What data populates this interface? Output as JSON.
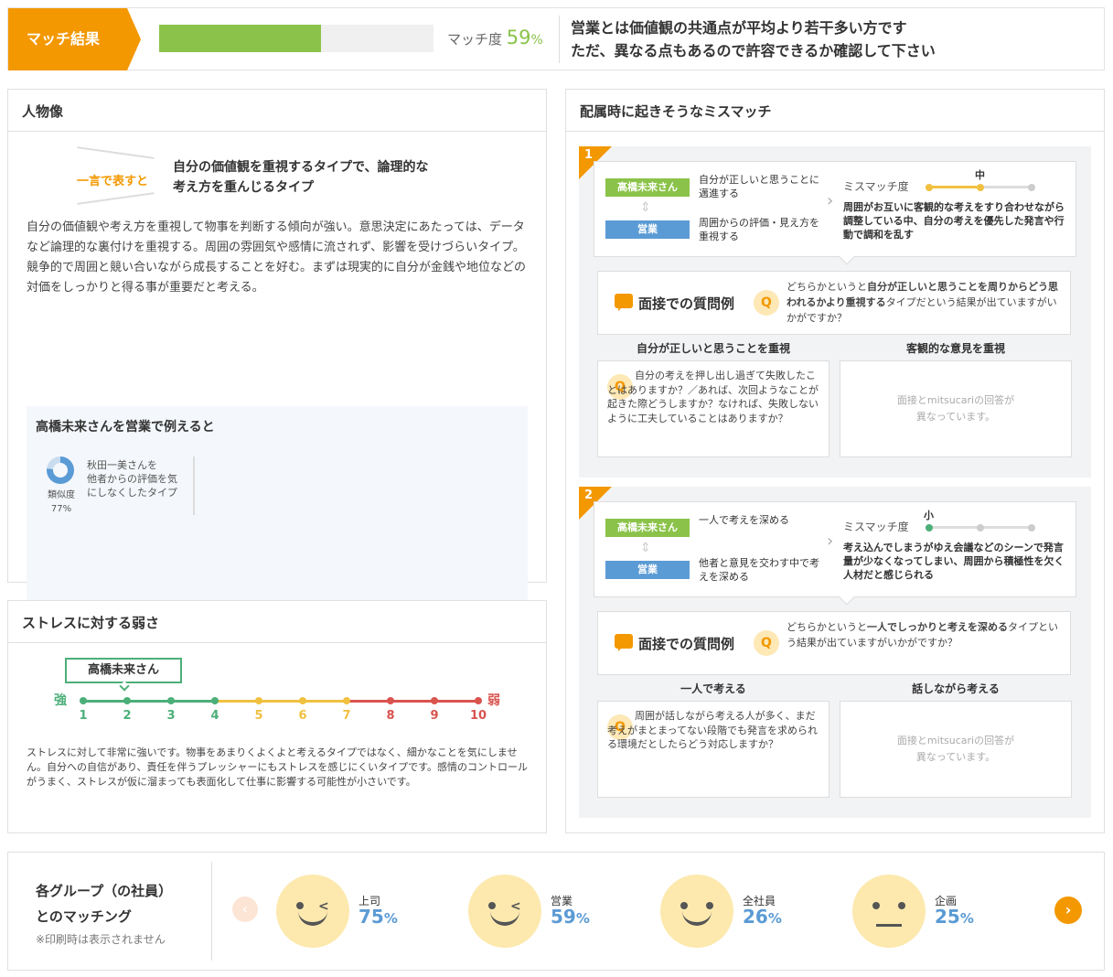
{
  "header": {
    "badge": "マッチ結果",
    "match_label": "マッチ度",
    "match_value": "59",
    "match_unit": "%",
    "match_fraction": 0.59,
    "message_line1": "営業とは価値観の共通点が平均より若干多い方です",
    "message_line2": "ただ、異なる点もあるので許容できるか確認して下さい"
  },
  "persona": {
    "title": "人物像",
    "one_word_label": "一言で表すと",
    "one_word_line1": "自分の価値観を重視するタイプで、論理的な",
    "one_word_line2": "考え方を重んじるタイプ",
    "description": "自分の価値観や考え方を重視して物事を判断する傾向が強い。意思決定にあたっては、データなど論理的な裏付けを重視する。周囲の雰囲気や感情に流されず、影響を受けづらいタイプ。競争的で周囲と競い合いながら成長することを好む。まずは現実的に自分が金銭や地位などの対価をしっかりと得る事が重要だと考える。",
    "example_title": "高橋未来さんを営業で例えると",
    "similarity_label": "類似度",
    "similarity_value": "77%",
    "similar_line1": "秋田一美さんを",
    "similar_line2": "他者からの評価を気",
    "similar_line3": "にしなくしたタイプ"
  },
  "stress": {
    "title": "ストレスに対する弱さ",
    "person": "高橋未来さん",
    "strong_label": "強",
    "weak_label": "弱",
    "scale": [
      "1",
      "2",
      "3",
      "4",
      "5",
      "6",
      "7",
      "8",
      "9",
      "10"
    ],
    "position": 2,
    "colors": {
      "green": "#4caf78",
      "yellow": "#f0c040",
      "red": "#d9534f"
    },
    "description": "ストレスに対して非常に強いです。物事をあまりくよくよと考えるタイプではなく、細かなことを気にしません。自分への自信があり、責任を伴うプレッシャーにもストレスを感じにくいタイプです。感情のコントロールがうまく、ストレスが仮に溜まっても表面化して仕事に影響する可能性が小さいです。"
  },
  "mismatch": {
    "title": "配属時に起きそうなミスマッチ",
    "items": [
      {
        "num": "1",
        "person_tag": "高橋未来さん",
        "group_tag": "営業",
        "person_text": "自分が正しいと思うことに邁進する",
        "group_text": "周囲からの評価・見え方を重視する",
        "level_label": "ミスマッチ度",
        "level": "中",
        "level_index": 1,
        "description": "周囲がお互いに客観的な考えをすり合わせながら調整している中、自分の考えを優先した発言や行動で調和を乱す",
        "interview_label": "面接での質問例",
        "q_icon": "Q",
        "interview_q_pre": "どちらかというと",
        "interview_q_bold": "自分が正しいと思うことを周りからどう思われるかより重視する",
        "interview_q_post": "タイプだという結果が出ていますがいかがですか？",
        "ans_left_head": "自分が正しいと思うことを重視",
        "ans_right_head": "客観的な意見を重視",
        "ans_left_text": "自分の考えを押し出し過ぎて失敗したことはありますか？／あれば、次回ようなことが起きた際どうしますか？なければ、失敗しないように工夫していることはありますか？",
        "ans_right_line1": "面接とmitsucariの回答が",
        "ans_right_line2": "異なっています。"
      },
      {
        "num": "2",
        "person_tag": "高橋未来さん",
        "group_tag": "営業",
        "person_text": "一人で考えを深める",
        "group_text": "他者と意見を交わす中で考えを深める",
        "level_label": "ミスマッチ度",
        "level": "小",
        "level_index": 0,
        "description": "考え込んでしまうがゆえ会議などのシーンで発言量が少なくなってしまい、周囲から積極性を欠く人材だと感じられる",
        "interview_label": "面接での質問例",
        "q_icon": "Q",
        "interview_q_pre": "どちらかというと",
        "interview_q_bold": "一人でしっかりと考えを深める",
        "interview_q_post": "タイプという結果が出ていますがいかがですか？",
        "ans_left_head": "一人で考える",
        "ans_right_head": "話しながら考える",
        "ans_left_text": "周囲が話しながら考える人が多く、まだ考えがまとまってない段階でも発言を求められる環境だとしたらどう対応しますか？",
        "ans_right_line1": "面接とmitsucariの回答が",
        "ans_right_line2": "異なっています。"
      }
    ]
  },
  "groups": {
    "title_line1": "各グループ（の社員）",
    "title_line2": "とのマッチング",
    "note": "※印刷時は表示されません",
    "items": [
      {
        "name": "上司",
        "value": "75",
        "unit": "%",
        "face": "wink-smile"
      },
      {
        "name": "営業",
        "value": "59",
        "unit": "%",
        "face": "wink-smile"
      },
      {
        "name": "全社員",
        "value": "26",
        "unit": "%",
        "face": "smile"
      },
      {
        "name": "企画",
        "value": "25",
        "unit": "%",
        "face": "neutral"
      }
    ],
    "prev_icon": "‹",
    "next_icon": "›"
  },
  "colors": {
    "orange": "#f39800",
    "green": "#8bc34a",
    "blue": "#5b9bd5"
  }
}
